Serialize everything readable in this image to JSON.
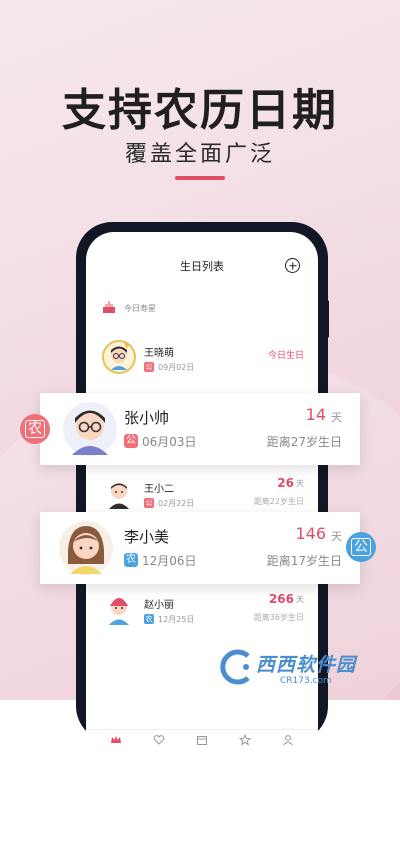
{
  "headline": "支持农历日期",
  "subheadline": "覆盖全面广泛",
  "colors": {
    "accent": "#e14c66",
    "lunar_badge": "#f07079",
    "solar_badge": "#4aa3df",
    "phone_frame": "#121726"
  },
  "app": {
    "title": "生日列表",
    "add_icon": "plus-circle-icon",
    "today_section_label": "今日寿星"
  },
  "list": [
    {
      "name": "王晓萌",
      "badge": "公",
      "badge_type": "solar",
      "date": "09月02日",
      "status": "今日生日"
    },
    {
      "name": "王小二",
      "badge": "公",
      "badge_type": "solar",
      "date": "02月22日",
      "days": "26",
      "unit": "天",
      "until": "距离22岁生日"
    },
    {
      "name": "赵小丽",
      "badge": "农",
      "badge_type": "lunar",
      "date": "12月25日",
      "days": "266",
      "unit": "天",
      "until": "距离36岁生日"
    }
  ],
  "cards": [
    {
      "name": "张小帅",
      "badge": "公",
      "badge_type": "solar",
      "date": "06月03日",
      "days": "14",
      "unit": "天",
      "until": "距离27岁生日",
      "chip": "农"
    },
    {
      "name": "李小美",
      "badge": "农",
      "badge_type": "lunar",
      "date": "12月06日",
      "days": "146",
      "unit": "天",
      "until": "距离17岁生日",
      "chip": "公"
    }
  ],
  "nav": [
    "crown-icon",
    "heart-icon",
    "calendar-icon",
    "star-icon",
    "person-icon"
  ],
  "watermark": {
    "big": "西西软件园",
    "small": "CR173.com"
  }
}
